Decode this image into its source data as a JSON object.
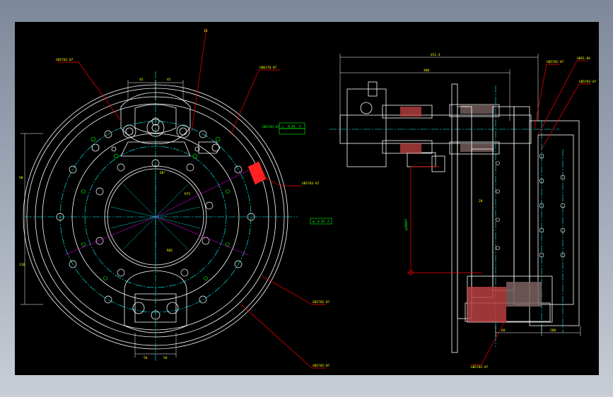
{
  "drawing": {
    "background": "#000000",
    "frame_color": "#8e98a9",
    "colors": {
      "outline": "#ffffff",
      "centerline": "#00ffff",
      "dimension": "#ffffff",
      "leader": "#ff0000",
      "hatch": "#ff3333",
      "tolerance_box": "#00ff00",
      "hidden": "#ffff00",
      "green": "#00ff00"
    },
    "left_view": {
      "callouts": [
        "GB5782-87",
        "10",
        "GB6170-87",
        "GB5783-87",
        "GB5782-87",
        "GB5782-87",
        "GB5783-87"
      ],
      "dimensions": [
        "45",
        "45",
        "90",
        "110",
        "50",
        "50"
      ],
      "tolerance": [
        "⊥",
        "0.01",
        "A"
      ],
      "tolerance2": [
        "φ",
        "0.05",
        "A"
      ],
      "angle": "60°",
      "radius_notes": [
        "R75",
        "R85"
      ]
    },
    "right_view": {
      "callouts": [
        "GB5782-87",
        "GB91-86",
        "GB5783-87",
        "GB5782-87"
      ],
      "dimensions": [
        "452.4",
        "400",
        "200",
        "20",
        "60",
        "φ300H7"
      ]
    }
  }
}
